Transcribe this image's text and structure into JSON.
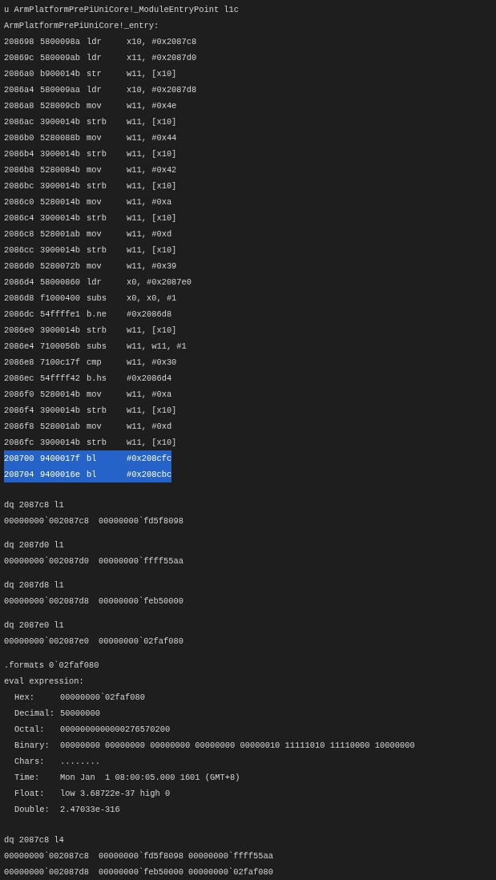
{
  "command": "u ArmPlatformPrePiUniCore!_ModuleEntryPoint l1c",
  "disassembly": {
    "label": "ArmPlatformPrePiUniCore!_entry:",
    "rows": [
      {
        "address": "208698",
        "opcode": "5800098a",
        "mnemonic": "ldr",
        "operands": "x10, #0x2087c8",
        "selected": false
      },
      {
        "address": "20869c",
        "opcode": "580009ab",
        "mnemonic": "ldr",
        "operands": "x11, #0x2087d0",
        "selected": false
      },
      {
        "address": "2086a0",
        "opcode": "b900014b",
        "mnemonic": "str",
        "operands": "w11, [x10]",
        "selected": false
      },
      {
        "address": "2086a4",
        "opcode": "580009aa",
        "mnemonic": "ldr",
        "operands": "x10, #0x2087d8",
        "selected": false
      },
      {
        "address": "2086a8",
        "opcode": "528009cb",
        "mnemonic": "mov",
        "operands": "w11, #0x4e",
        "selected": false
      },
      {
        "address": "2086ac",
        "opcode": "3900014b",
        "mnemonic": "strb",
        "operands": "w11, [x10]",
        "selected": false
      },
      {
        "address": "2086b0",
        "opcode": "5280088b",
        "mnemonic": "mov",
        "operands": "w11, #0x44",
        "selected": false
      },
      {
        "address": "2086b4",
        "opcode": "3900014b",
        "mnemonic": "strb",
        "operands": "w11, [x10]",
        "selected": false
      },
      {
        "address": "2086b8",
        "opcode": "5280084b",
        "mnemonic": "mov",
        "operands": "w11, #0x42",
        "selected": false
      },
      {
        "address": "2086bc",
        "opcode": "3900014b",
        "mnemonic": "strb",
        "operands": "w11, [x10]",
        "selected": false
      },
      {
        "address": "2086c0",
        "opcode": "5280014b",
        "mnemonic": "mov",
        "operands": "w11, #0xa",
        "selected": false
      },
      {
        "address": "2086c4",
        "opcode": "3900014b",
        "mnemonic": "strb",
        "operands": "w11, [x10]",
        "selected": false
      },
      {
        "address": "2086c8",
        "opcode": "528001ab",
        "mnemonic": "mov",
        "operands": "w11, #0xd",
        "selected": false
      },
      {
        "address": "2086cc",
        "opcode": "3900014b",
        "mnemonic": "strb",
        "operands": "w11, [x10]",
        "selected": false
      },
      {
        "address": "2086d0",
        "opcode": "5280072b",
        "mnemonic": "mov",
        "operands": "w11, #0x39",
        "selected": false
      },
      {
        "address": "2086d4",
        "opcode": "58000860",
        "mnemonic": "ldr",
        "operands": "x0, #0x2087e0",
        "selected": false
      },
      {
        "address": "2086d8",
        "opcode": "f1000400",
        "mnemonic": "subs",
        "operands": "x0, x0, #1",
        "selected": false
      },
      {
        "address": "2086dc",
        "opcode": "54ffffe1",
        "mnemonic": "b.ne",
        "operands": "#0x2086d8",
        "selected": false
      },
      {
        "address": "2086e0",
        "opcode": "3900014b",
        "mnemonic": "strb",
        "operands": "w11, [x10]",
        "selected": false
      },
      {
        "address": "2086e4",
        "opcode": "7100056b",
        "mnemonic": "subs",
        "operands": "w11, w11, #1",
        "selected": false
      },
      {
        "address": "2086e8",
        "opcode": "7100c17f",
        "mnemonic": "cmp",
        "operands": "w11, #0x30",
        "selected": false
      },
      {
        "address": "2086ec",
        "opcode": "54ffff42",
        "mnemonic": "b.hs",
        "operands": "#0x2086d4",
        "selected": false
      },
      {
        "address": "2086f0",
        "opcode": "5280014b",
        "mnemonic": "mov",
        "operands": "w11, #0xa",
        "selected": false
      },
      {
        "address": "2086f4",
        "opcode": "3900014b",
        "mnemonic": "strb",
        "operands": "w11, [x10]",
        "selected": false
      },
      {
        "address": "2086f8",
        "opcode": "528001ab",
        "mnemonic": "mov",
        "operands": "w11, #0xd",
        "selected": false
      },
      {
        "address": "2086fc",
        "opcode": "3900014b",
        "mnemonic": "strb",
        "operands": "w11, [x10]",
        "selected": false
      },
      {
        "address": "208700",
        "opcode": "9400017f",
        "mnemonic": "bl",
        "operands": "#0x208cfc",
        "selected": true
      },
      {
        "address": "208704",
        "opcode": "9400016e",
        "mnemonic": "bl",
        "operands": "#0x208cbc",
        "selected": true
      }
    ]
  },
  "sections": [
    {
      "kind": "dump",
      "command": "dq 2087c8 l1",
      "lines": [
        {
          "address": "00000000`002087c8",
          "values": [
            "00000000`fd5f8098"
          ]
        }
      ]
    },
    {
      "kind": "dump",
      "command": "dq 2087d0 l1",
      "lines": [
        {
          "address": "00000000`002087d0",
          "values": [
            "00000000`ffff55aa"
          ]
        }
      ]
    },
    {
      "kind": "dump",
      "command": "dq 2087d8 l1",
      "lines": [
        {
          "address": "00000000`002087d8",
          "values": [
            "00000000`feb50000"
          ]
        }
      ]
    },
    {
      "kind": "dump",
      "command": "dq 2087e0 l1",
      "lines": [
        {
          "address": "00000000`002087e0",
          "values": [
            "00000000`02faf080"
          ]
        }
      ]
    },
    {
      "kind": "formats",
      "command": ".formats 0`02faf080",
      "heading": "eval expression:",
      "fields": [
        {
          "label": "Hex:",
          "value": "00000000`02faf080"
        },
        {
          "label": "Decimal:",
          "value": "50000000"
        },
        {
          "label": "Octal:",
          "value": "0000000000000276570200"
        },
        {
          "label": "Binary:",
          "value": "00000000 00000000 00000000 00000000 00000010 11111010 11110000 10000000"
        },
        {
          "label": "Chars:",
          "value": "........"
        },
        {
          "label": "Time:",
          "value": "Mon Jan  1 08:00:05.000 1601 (GMT+8)"
        },
        {
          "label": "Float:",
          "value": "low 3.68722e-37 high 0"
        },
        {
          "label": "Double:",
          "value": "2.47033e-316"
        }
      ]
    },
    {
      "kind": "dump",
      "command": "dq 2087c8 l4",
      "lines": [
        {
          "address": "00000000`002087c8",
          "values": [
            "00000000`fd5f8098",
            "00000000`ffff55aa"
          ]
        },
        {
          "address": "00000000`002087d8",
          "values": [
            "00000000`feb50000",
            "00000000`02faf080"
          ]
        }
      ]
    }
  ]
}
